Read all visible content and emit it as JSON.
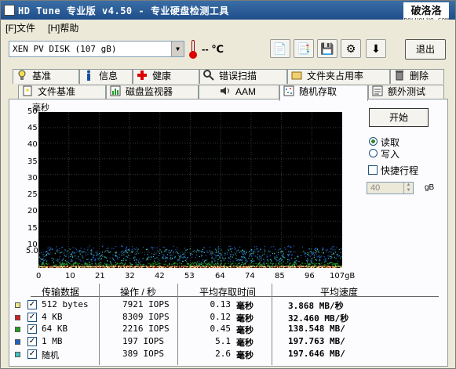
{
  "window": {
    "title": "HD Tune 专业版 v4.50 - 专业硬盘检测工具"
  },
  "watermark": {
    "text": "破洛洛",
    "url": "POLUOLUO.COM"
  },
  "menu": {
    "file": "[F]文件",
    "help": "[H]帮助"
  },
  "toolbar": {
    "drive": "XEN    PV DISK         (107 gB)",
    "temperature": "-- ℃",
    "exit": "退出",
    "buttons": [
      "copy-text-icon",
      "copy-screenshot-icon",
      "save-icon",
      "options-icon",
      "download-icon"
    ]
  },
  "tabs_row1": [
    {
      "label": "基准",
      "icon": "bulb-icon"
    },
    {
      "label": "信息",
      "icon": "info-icon"
    },
    {
      "label": "健康",
      "icon": "health-icon"
    },
    {
      "label": "错误扫描",
      "icon": "magnifier-icon"
    },
    {
      "label": "文件夹占用率",
      "icon": "folder-icon"
    },
    {
      "label": "删除",
      "icon": "trash-icon"
    }
  ],
  "tabs_row2": [
    {
      "label": "文件基准",
      "icon": "file-benchmark-icon"
    },
    {
      "label": "磁盘监视器",
      "icon": "monitor-icon"
    },
    {
      "label": "AAM",
      "icon": "speaker-icon"
    },
    {
      "label": "随机存取",
      "icon": "random-access-icon",
      "active": true
    },
    {
      "label": "额外测试",
      "icon": "extra-tests-icon"
    }
  ],
  "controls": {
    "start": "开始",
    "read": "读取",
    "write": "写入",
    "read_selected": true,
    "short_stroke": "快捷行程",
    "short_stroke_checked": false,
    "stroke_value": "40",
    "stroke_unit": "gB"
  },
  "table": {
    "headers": [
      "传输数据",
      "操作 / 秒",
      "平均存取时间",
      "平均速度"
    ],
    "rows": [
      {
        "color": "#f0e68c",
        "label": "512 bytes",
        "ops": "7921 IOPS",
        "time": "0.13",
        "time_unit": "毫秒",
        "speed": "3.868 MB/秒"
      },
      {
        "color": "#d02020",
        "label": "4 KB",
        "ops": "8309 IOPS",
        "time": "0.12",
        "time_unit": "毫秒",
        "speed": "32.460 MB/秒"
      },
      {
        "color": "#20a020",
        "label": "64 KB",
        "ops": "2216 IOPS",
        "time": "0.45",
        "time_unit": "毫秒",
        "speed": "138.548 MB/"
      },
      {
        "color": "#2060c0",
        "label": "1 MB",
        "ops": "197 IOPS",
        "time": "5.1",
        "time_unit": "毫秒",
        "speed": "197.763 MB/"
      },
      {
        "color": "#40c0c0",
        "label": "随机",
        "ops": "389 IOPS",
        "time": "2.6",
        "time_unit": "毫秒",
        "speed": "197.646 MB/"
      }
    ]
  },
  "chart_data": {
    "type": "scatter",
    "ylabel": "毫秒",
    "ylim": [
      0,
      50
    ],
    "xlim": [
      0,
      107
    ],
    "y_ticks": [
      "50",
      "45",
      "40",
      "35",
      "30",
      "25",
      "20",
      "15",
      "10",
      "5.0"
    ],
    "x_ticks": [
      "0",
      "10",
      "21",
      "32",
      "42",
      "53",
      "64",
      "74",
      "85",
      "96",
      "107gB"
    ],
    "grid": true,
    "series": [
      {
        "color": "#f0e68c",
        "band": [
          0,
          0.5
        ]
      },
      {
        "color": "#d02020",
        "band": [
          0,
          0.5
        ]
      },
      {
        "color": "#20a020",
        "band": [
          0.2,
          1.5
        ]
      },
      {
        "color": "#2060c0",
        "band": [
          2,
          7
        ]
      },
      {
        "color": "#40c0c0",
        "band": [
          1,
          6
        ]
      }
    ]
  }
}
